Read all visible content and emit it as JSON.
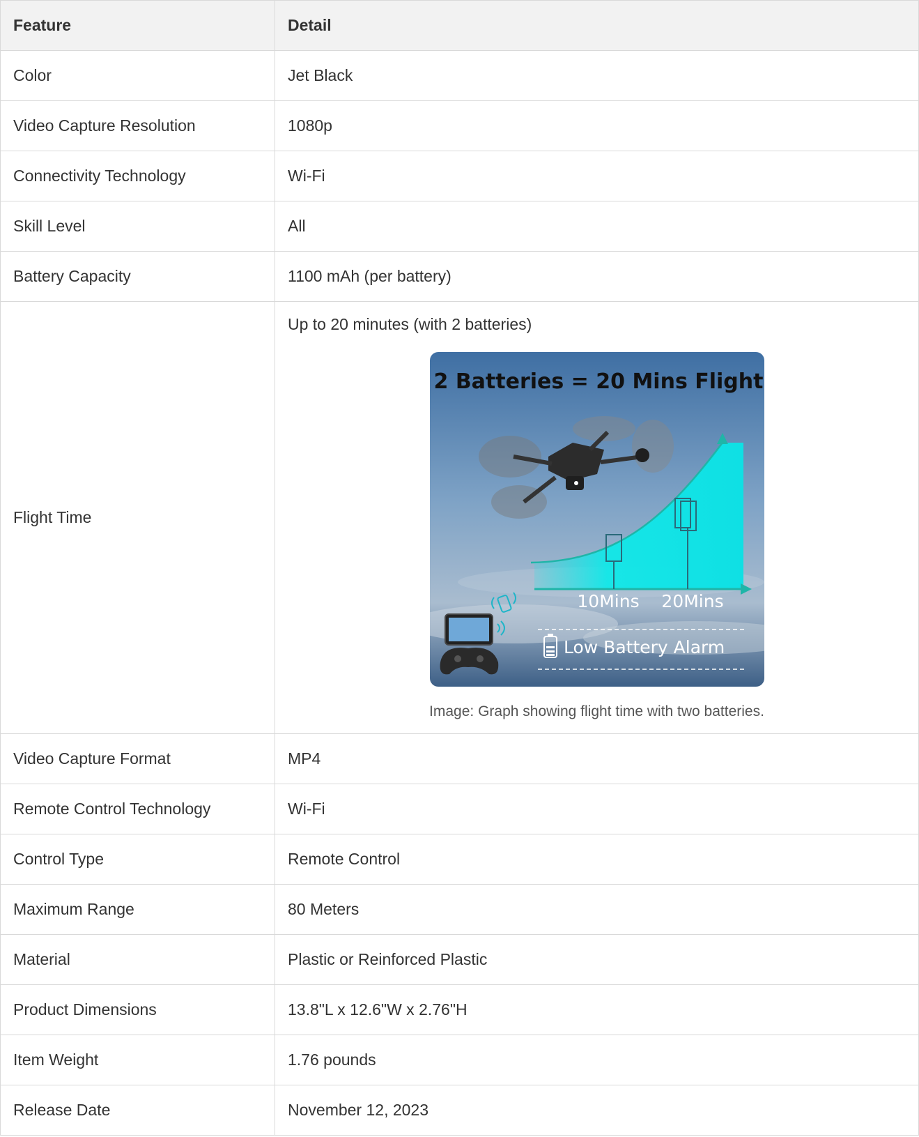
{
  "table": {
    "headers": [
      "Feature",
      "Detail"
    ],
    "rows": [
      {
        "feature": "Color",
        "detail": "Jet Black"
      },
      {
        "feature": "Video Capture Resolution",
        "detail": "1080p"
      },
      {
        "feature": "Connectivity Technology",
        "detail": "Wi-Fi"
      },
      {
        "feature": "Skill Level",
        "detail": "All"
      },
      {
        "feature": "Battery Capacity",
        "detail": "1100 mAh (per battery)"
      },
      {
        "feature": "Flight Time",
        "detail": "Up to 20 minutes (with 2 batteries)"
      },
      {
        "feature": "Video Capture Format",
        "detail": "MP4"
      },
      {
        "feature": "Remote Control Technology",
        "detail": "Wi-Fi"
      },
      {
        "feature": "Control Type",
        "detail": "Remote Control"
      },
      {
        "feature": "Maximum Range",
        "detail": "80 Meters"
      },
      {
        "feature": "Material",
        "detail": "Plastic or Reinforced Plastic"
      },
      {
        "feature": "Product Dimensions",
        "detail": "13.8\"L x 12.6\"W x 2.76\"H"
      },
      {
        "feature": "Item Weight",
        "detail": "1.76 pounds"
      },
      {
        "feature": "Release Date",
        "detail": "November 12, 2023"
      }
    ]
  },
  "flight_image": {
    "title": "2 Batteries = 20 Mins Flight",
    "tick_labels": [
      "10Mins",
      "20Mins"
    ],
    "alarm_label": "Low Battery Alarm",
    "caption": "Image: Graph showing flight time with two batteries.",
    "colors": {
      "sky_top": "#4a78a8",
      "sky_bottom": "#b7c6d6",
      "curve_fill": "#10e8e8",
      "axis": "#1fb5a8"
    }
  }
}
